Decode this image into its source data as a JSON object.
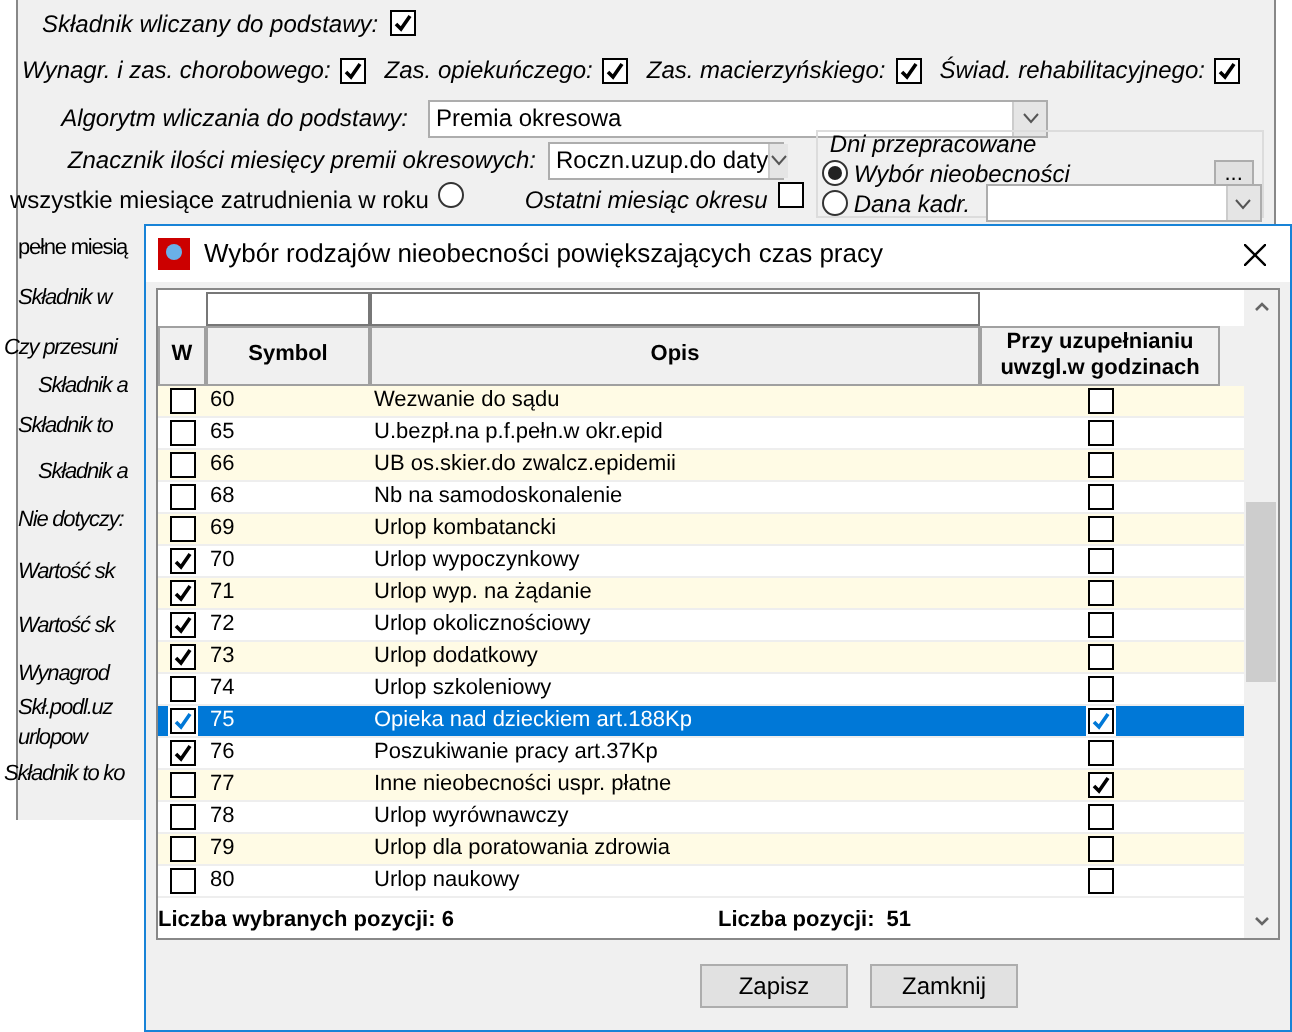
{
  "form": {
    "title": "Składnik wliczany do podstawy:",
    "title_checked": true,
    "checks": [
      {
        "label": "Wynagr. i zas. chorobowego:",
        "checked": true
      },
      {
        "label": "Zas. opiekuńczego:",
        "checked": true
      },
      {
        "label": "Zas. macierzyńskiego:",
        "checked": true
      },
      {
        "label": "Świad. rehabilitacyjnego:",
        "checked": true
      }
    ],
    "algorithm": {
      "label": "Algorytm wliczania do podstawy:",
      "value": "Premia okresowa"
    },
    "months_marker": {
      "label": "Znacznik ilości miesięcy premii okresowych:",
      "value": "Roczn.uzup.do daty"
    },
    "worked_days": {
      "title": "Dni przepracowane",
      "button": "...",
      "options": [
        {
          "label": "Wybór nieobecności",
          "selected": true
        },
        {
          "label": "Dana kadr.",
          "selected": false
        }
      ]
    },
    "all_months": {
      "label": "wszystkie miesiące zatrudnienia w roku",
      "selected": false
    },
    "last_month": {
      "label": "Ostatni miesiąc okresu",
      "checked": false
    },
    "cut_labels": [
      {
        "text": "pełne miesią",
        "kind": "plain"
      },
      {
        "text": "Składnik w",
        "kind": "italic"
      },
      {
        "text": "Czy przesuni",
        "kind": "outer"
      },
      {
        "text": "Składnik a",
        "kind": "group"
      },
      {
        "text": "Składnik to",
        "kind": "italic"
      },
      {
        "text": "Składnik a",
        "kind": "group"
      },
      {
        "text": "Nie dotyczy:",
        "kind": "italic"
      },
      {
        "text": "Wartość sk",
        "kind": "italic"
      },
      {
        "text": "Wartość sk",
        "kind": "italic"
      },
      {
        "text": "Wynagrod",
        "kind": "italic"
      },
      {
        "text": "Skł.podl.uz",
        "kind": "italic"
      },
      {
        "text": "urlopow",
        "kind": "italic"
      },
      {
        "text": "Składnik to ko",
        "kind": "outer"
      }
    ]
  },
  "dialog": {
    "title": "Wybór rodzajów nieobecności powiększających czas pracy",
    "columns": [
      "W",
      "Symbol",
      "Opis",
      "Przy uzupełnianiu uwzgl.w godzinach"
    ],
    "rows": [
      {
        "symbol": "60",
        "opis": "Wezwanie do sądu",
        "checked": false,
        "hours": false,
        "selected": false
      },
      {
        "symbol": "65",
        "opis": "U.bezpł.na p.f.pełn.w okr.epid",
        "checked": false,
        "hours": false,
        "selected": false
      },
      {
        "symbol": "66",
        "opis": "UB os.skier.do zwalcz.epidemii",
        "checked": false,
        "hours": false,
        "selected": false
      },
      {
        "symbol": "68",
        "opis": "Nb na samodoskonalenie",
        "checked": false,
        "hours": false,
        "selected": false
      },
      {
        "symbol": "69",
        "opis": "Urlop kombatancki",
        "checked": false,
        "hours": false,
        "selected": false
      },
      {
        "symbol": "70",
        "opis": "Urlop wypoczynkowy",
        "checked": true,
        "hours": false,
        "selected": false
      },
      {
        "symbol": "71",
        "opis": "Urlop wyp. na żądanie",
        "checked": true,
        "hours": false,
        "selected": false
      },
      {
        "symbol": "72",
        "opis": "Urlop okolicznościowy",
        "checked": true,
        "hours": false,
        "selected": false
      },
      {
        "symbol": "73",
        "opis": "Urlop dodatkowy",
        "checked": true,
        "hours": false,
        "selected": false
      },
      {
        "symbol": "74",
        "opis": "Urlop szkoleniowy",
        "checked": false,
        "hours": false,
        "selected": false
      },
      {
        "symbol": "75",
        "opis": "Opieka nad dzieckiem art.188Kp",
        "checked": true,
        "hours": true,
        "selected": true
      },
      {
        "symbol": "76",
        "opis": "Poszukiwanie pracy art.37Kp",
        "checked": true,
        "hours": false,
        "selected": false
      },
      {
        "symbol": "77",
        "opis": "Inne nieobecności uspr. płatne",
        "checked": false,
        "hours": true,
        "selected": false
      },
      {
        "symbol": "78",
        "opis": "Urlop wyrównawczy",
        "checked": false,
        "hours": false,
        "selected": false
      },
      {
        "symbol": "79",
        "opis": "Urlop dla poratowania zdrowia",
        "checked": false,
        "hours": false,
        "selected": false
      },
      {
        "symbol": "80",
        "opis": "Urlop naukowy",
        "checked": false,
        "hours": false,
        "selected": false
      }
    ],
    "selected_count_label": "Liczba wybranych pozycji: 6",
    "total_label": "Liczba pozycji:",
    "total_value": "51",
    "buttons": [
      "Zapisz",
      "Zamknij"
    ]
  }
}
